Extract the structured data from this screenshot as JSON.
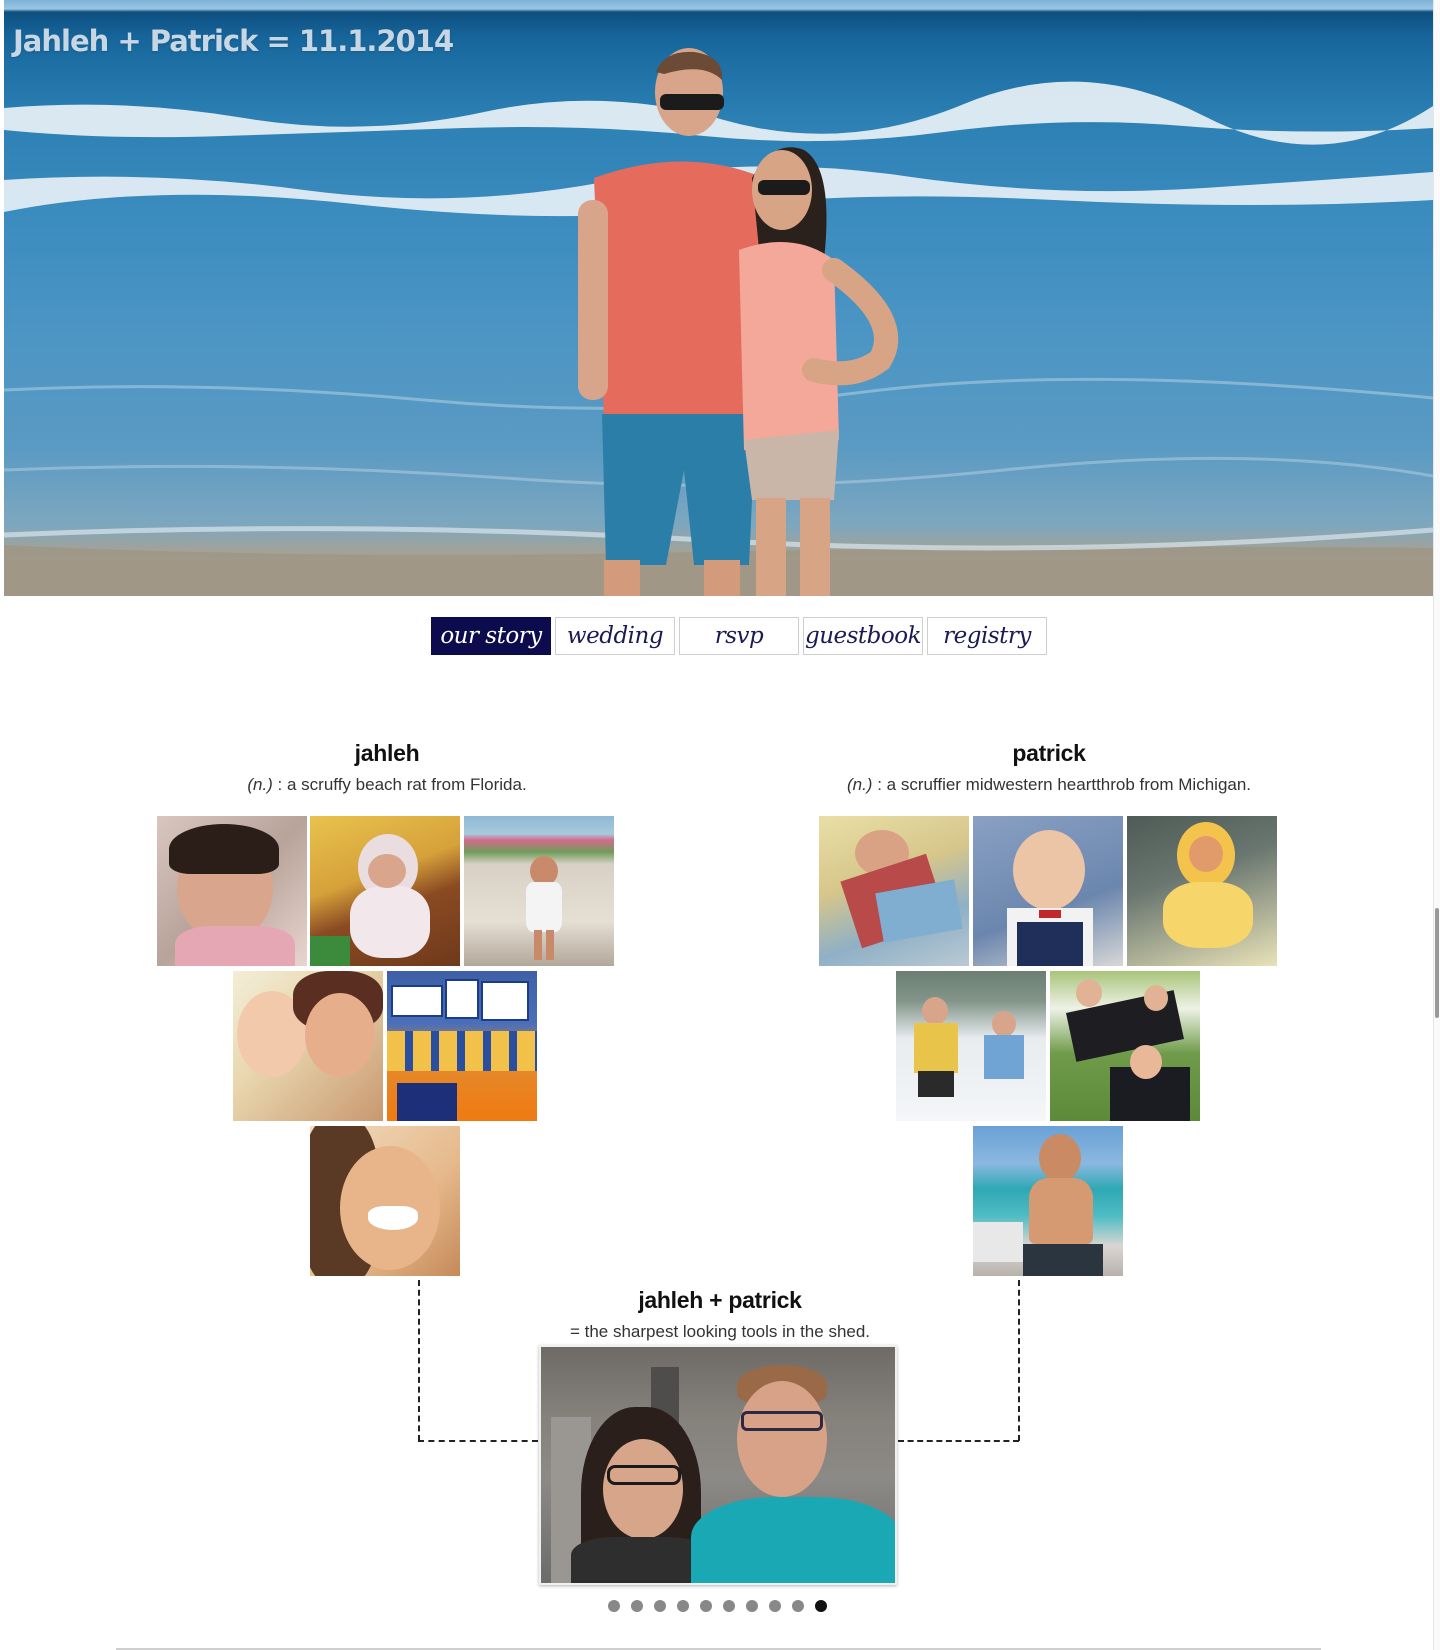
{
  "site": {
    "title": "Jahleh + Patrick = 11.1.2014"
  },
  "nav": {
    "tabs": [
      {
        "label": "our story",
        "active": true
      },
      {
        "label": "wedding",
        "active": false
      },
      {
        "label": "rsvp",
        "active": false
      },
      {
        "label": "guestbook",
        "active": false
      },
      {
        "label": "registry",
        "active": false
      }
    ]
  },
  "jahleh": {
    "name": "jahleh",
    "pos": "(n.)",
    "definition": " : a scruffy beach rat from Florida."
  },
  "patrick": {
    "name": "patrick",
    "pos": "(n.)",
    "definition": " : a scruffier midwestern heartthrob from Michigan."
  },
  "couple": {
    "title": "jahleh + patrick",
    "definition": "= the sharpest looking tools in the shed."
  },
  "slideshow": {
    "total": 10,
    "active_index": 9
  },
  "colors": {
    "nav_active": "#0b0b4d",
    "nav_text": "#1a1a55",
    "dot": "#888888",
    "dot_active": "#111111"
  }
}
